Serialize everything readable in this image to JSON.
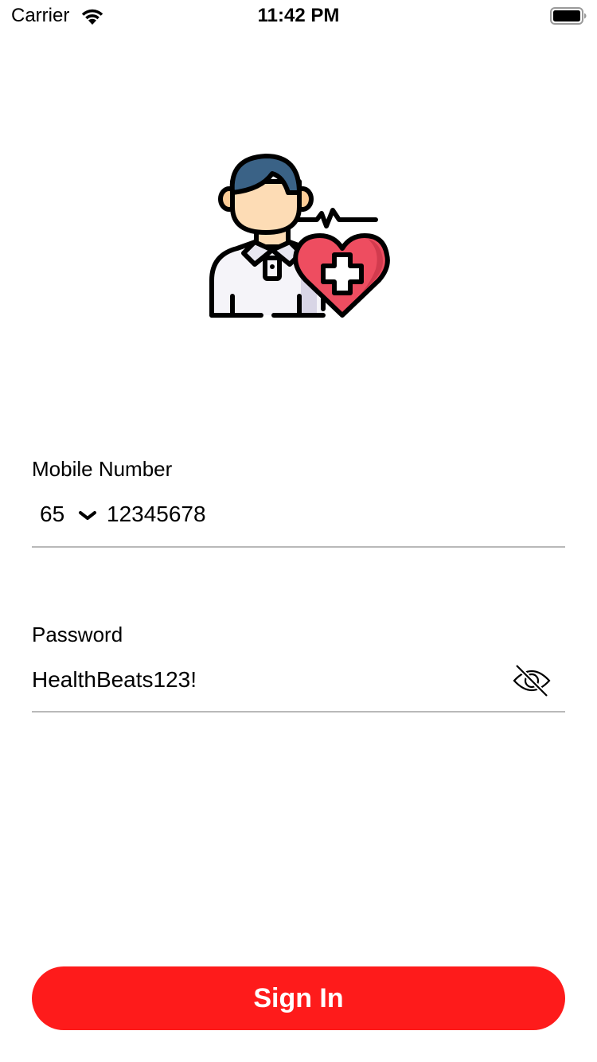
{
  "status_bar": {
    "carrier": "Carrier",
    "time": "11:42 PM",
    "wifi_icon": "wifi-icon",
    "battery_icon": "battery-full-icon"
  },
  "hero": {
    "icon": "doctor-with-heart-illustration",
    "colors": {
      "hair": "#3a6286",
      "skin": "#fddcb5",
      "shirt": "#f5f4f9",
      "heart": "#ee4d60",
      "outline": "#000000"
    }
  },
  "mobile": {
    "label": "Mobile Number",
    "country_code": "65",
    "value": "12345678",
    "chevron_icon": "chevron-down-icon"
  },
  "password": {
    "label": "Password",
    "value": "HealthBeats123!",
    "toggle_icon": "eye-slash-icon"
  },
  "sign_in": {
    "label": "Sign In",
    "color": "#fe1b1b"
  }
}
